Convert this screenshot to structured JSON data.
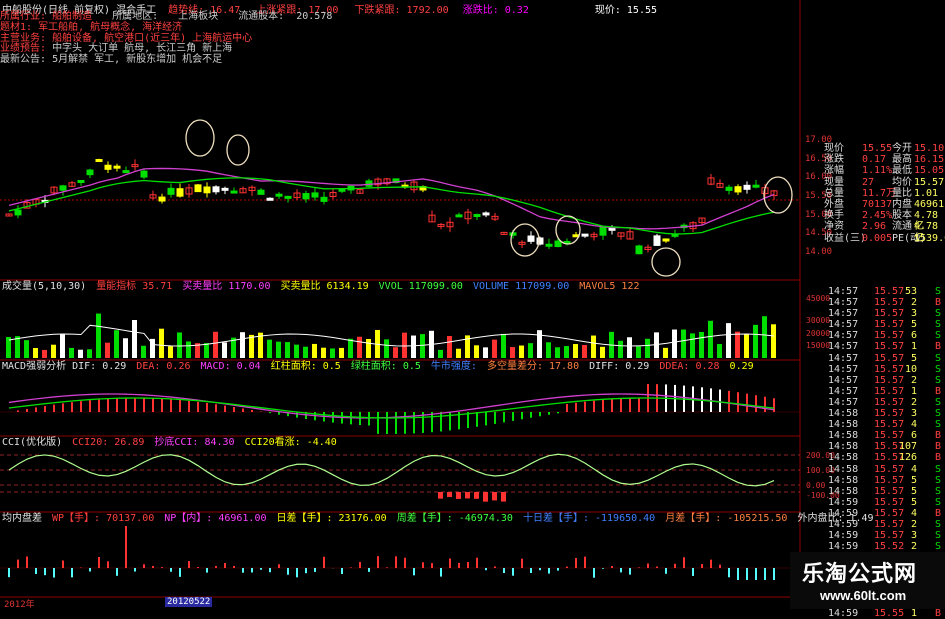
{
  "colors": {
    "up": "#ff3232",
    "down": "#54fcfc",
    "green_candle": "#00e000",
    "yellow": "#ffff00",
    "white": "#ffffff",
    "purple": "#ff00ff",
    "grid": "#8b0000",
    "text": "#c8c8c8",
    "ma_green": "#00e000",
    "ma_purple": "#d040d0"
  },
  "header": {
    "title": "中船股份(日线 前复权) 混合手工",
    "ma1_label": "趋势线: 16.47",
    "ma2_label": "上涨紧跟: 17.00",
    "ma3_label": "下跌紧跟: 1792.00",
    "ma4_label": "涨跌比: 0.32",
    "price_label": "现价: 15.55"
  },
  "info": {
    "lines": [
      {
        "k": "所属行业:",
        "v": "船舶制造",
        "k2": "所属地区:",
        "v2": "上海板块",
        "k3": "流通股本:",
        "v3": "20.578",
        "extra": "题材比例"
      },
      {
        "k": "题材1:",
        "v": "军工船舶, 航母概念, 海洋经济"
      },
      {
        "k": "主营业务:",
        "v": "船舶设备, 航空港口(近三年) 上海航运中心"
      },
      {
        "k": "业绩预告:",
        "v": "中字头 大订单 航母, 长江三角 新上海"
      },
      {
        "k": "最新公告:",
        "v": "5月解禁 军工, 新股东增加 机会不足"
      }
    ]
  },
  "price_axis": [
    "17.00",
    "16.50",
    "16.00",
    "15.50",
    "15.00",
    "14.50",
    "14.00"
  ],
  "side_quote": [
    {
      "a": "现价",
      "b": "15.55",
      "c": "今开",
      "d": "15.10"
    },
    {
      "a": "涨跌",
      "b": "0.17",
      "c": "最高",
      "d": "16.15"
    },
    {
      "a": "涨幅",
      "b": "1.11%",
      "c": "最低",
      "d": "15.05"
    },
    {
      "a": "现量",
      "b": "27",
      "c": "均价",
      "d": "15.57"
    },
    {
      "a": "总量",
      "b": "11.7万",
      "c": "量比",
      "d": "1.01"
    },
    {
      "a": "外盘",
      "b": "70137",
      "c": "内盘",
      "d": "46961"
    },
    {
      "a": "换手",
      "b": "2.45%",
      "c": "股本",
      "d": "4.78亿"
    },
    {
      "a": "净资",
      "b": "2.96",
      "c": "流通",
      "d": "4.78亿"
    },
    {
      "a": "收益(三)",
      "b": "0.005",
      "c": "PE(动)",
      "d": "1539.0"
    }
  ],
  "ticks": [
    {
      "t": "14:57",
      "p": "15.57",
      "v": "53",
      "s": "S"
    },
    {
      "t": "14:57",
      "p": "15.57",
      "v": "2",
      "s": "B"
    },
    {
      "t": "14:57",
      "p": "15.57",
      "v": "3",
      "s": "S"
    },
    {
      "t": "14:57",
      "p": "15.57",
      "v": "5",
      "s": "S"
    },
    {
      "t": "14:57",
      "p": "15.57",
      "v": "6",
      "s": "S"
    },
    {
      "t": "14:57",
      "p": "15.57",
      "v": "1",
      "s": "B"
    },
    {
      "t": "14:57",
      "p": "15.57",
      "v": "5",
      "s": "S"
    },
    {
      "t": "14:57",
      "p": "15.57",
      "v": "10",
      "s": "S"
    },
    {
      "t": "14:57",
      "p": "15.57",
      "v": "2",
      "s": "S"
    },
    {
      "t": "14:57",
      "p": "15.57",
      "v": "1",
      "s": "B"
    },
    {
      "t": "14:57",
      "p": "15.57",
      "v": "2",
      "s": "S"
    },
    {
      "t": "14:58",
      "p": "15.57",
      "v": "3",
      "s": "S"
    },
    {
      "t": "14:58",
      "p": "15.57",
      "v": "4",
      "s": "S"
    },
    {
      "t": "14:58",
      "p": "15.57",
      "v": "6",
      "s": "B"
    },
    {
      "t": "14:58",
      "p": "15.57",
      "v": "107",
      "s": "B"
    },
    {
      "t": "14:58",
      "p": "15.57",
      "v": "126",
      "s": "B"
    },
    {
      "t": "14:58",
      "p": "15.57",
      "v": "4",
      "s": "S"
    },
    {
      "t": "14:58",
      "p": "15.57",
      "v": "5",
      "s": "S"
    },
    {
      "t": "14:58",
      "p": "15.57",
      "v": "5",
      "s": "S"
    },
    {
      "t": "14:59",
      "p": "15.57",
      "v": "5",
      "s": "S"
    },
    {
      "t": "14:59",
      "p": "15.57",
      "v": "4",
      "s": "B"
    },
    {
      "t": "14:59",
      "p": "15.57",
      "v": "2",
      "s": "S"
    },
    {
      "t": "14:59",
      "p": "15.57",
      "v": "3",
      "s": "S"
    },
    {
      "t": "14:59",
      "p": "15.52",
      "v": "2",
      "s": "S"
    },
    {
      "t": "14:59",
      "p": "15.52",
      "v": "679",
      "s": "S"
    },
    {
      "t": "14:59",
      "p": "15.55",
      "v": "5",
      "s": "B"
    },
    {
      "t": "14:59",
      "p": "15.55",
      "v": "5",
      "s": "B"
    },
    {
      "t": "14:59",
      "p": "15.55",
      "v": "11",
      "s": "S"
    },
    {
      "t": "14:59",
      "p": "15.55",
      "v": "8",
      "s": "S"
    },
    {
      "t": "14:59",
      "p": "15.55",
      "v": "1",
      "s": "B"
    }
  ],
  "panels": {
    "vol": {
      "items": [
        "成交量(5,10,30)",
        "量能指标 35.71",
        "买卖量比 1170.00",
        "买卖量比 6134.19",
        "VVOL 117099.00",
        "VOLUME 117099.00",
        "MAVOL5 122"
      ],
      "axis": [
        "45000",
        "30000",
        "20000",
        "15000"
      ]
    },
    "macd": {
      "items": [
        "MACD强弱分析 DIF: 0.29",
        "DEA: 0.26",
        "MACD: 0.04",
        "红柱面积: 0.5",
        "绿柱面积: 0.5",
        "牛市强度:",
        "多空量差分: 17.80",
        "DIFF: 0.29",
        "DDEA: 0.28",
        "0.29"
      ]
    },
    "cci": {
      "items": [
        "CCI(优化版)",
        "CCI20: 26.89",
        "抄底CCI: 84.30",
        "CCI20看涨: -4.40"
      ],
      "axis": [
        "200.00",
        "100.00",
        "0.00",
        "-100.00"
      ]
    },
    "flow": {
      "items": [
        "均内盘差",
        "WP【手】: 70137.00",
        "NP【内】: 46961.00",
        "日差【手】: 23176.00",
        "周差【手】: -46974.30",
        "十日差【手】: -119650.40",
        "月差【手】: -105215.50",
        "外内盘比: 1.49"
      ]
    }
  },
  "watermark": {
    "title": "乐淘公式网",
    "url": "www.60lt.com"
  },
  "date_axis": {
    "left": "2012年",
    "right": "20120522"
  }
}
